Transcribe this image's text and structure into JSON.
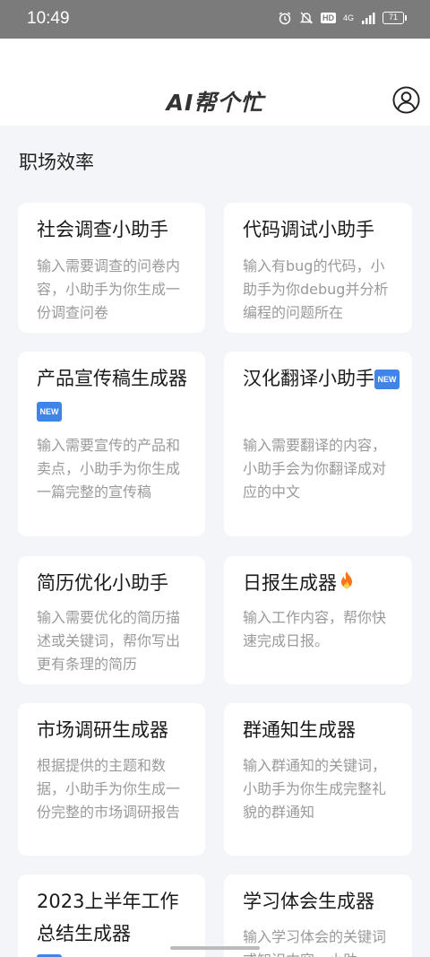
{
  "status_bar": {
    "time": "10:49",
    "network": "4G",
    "battery": "71",
    "hd": "HD"
  },
  "header": {
    "title": "AI帮个忙"
  },
  "section": {
    "title": "职场效率"
  },
  "cards": [
    {
      "title": "社会调查小助手",
      "desc": "输入需要调查的问卷内容，小助手为你生成一份调查问卷"
    },
    {
      "title": "代码调试小助手",
      "desc": "输入有bug的代码，小助手为你debug并分析编程的问题所在"
    },
    {
      "title": "产品宣传稿生成器",
      "badge": "NEW",
      "desc": "输入需要宣传的产品和卖点，小助手为你生成一篇完整的宣传稿"
    },
    {
      "title": "汉化翻译小助手",
      "badge": "NEW",
      "desc": "输入需要翻译的内容，小助手会为你翻译成对应的中文"
    },
    {
      "title": "简历优化小助手",
      "desc": "输入需要优化的简历描述或关键词，帮你写出更有条理的简历"
    },
    {
      "title": "日报生成器",
      "icon": "fire-icon",
      "desc": "输入工作内容，帮你快速完成日报。"
    },
    {
      "title": "市场调研生成器",
      "desc": "根据提供的主题和数据，小助手为你生成一份完整的市场调研报告"
    },
    {
      "title": "群通知生成器",
      "desc": "输入群通知的关键词，小助手为你生成完整礼貌的群通知"
    },
    {
      "title": "2023上半年工作总结生成器",
      "desc": ""
    },
    {
      "title": "学习体会生成器",
      "desc": "输入学习体会的关键词或知识内容，小助"
    }
  ]
}
